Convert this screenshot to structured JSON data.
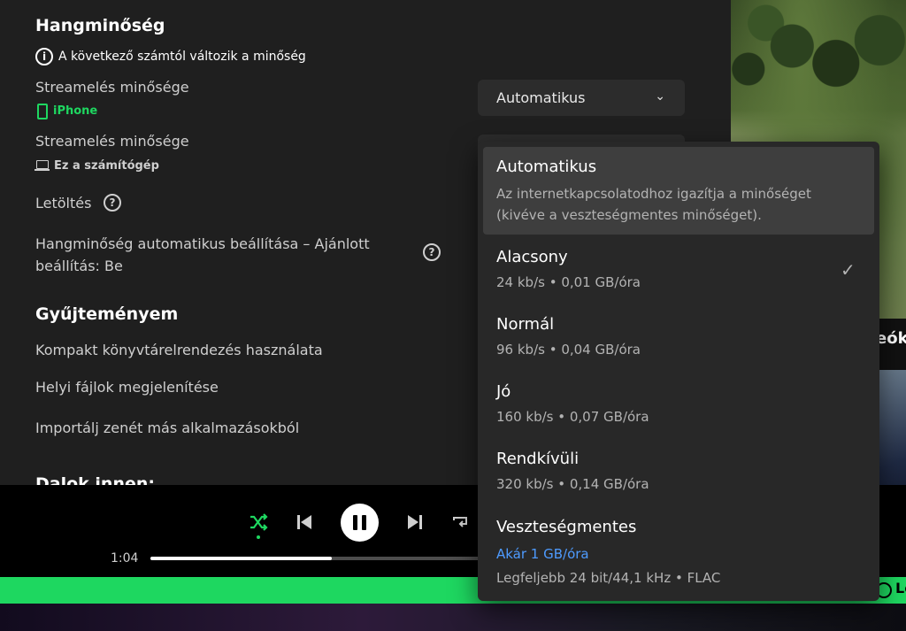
{
  "audio_quality": {
    "title": "Hangminőség",
    "notice": "A következő számtól változik a minőség",
    "streaming_label_1": "Streamelés minősége",
    "device_1": "iPhone",
    "streaming_label_2": "Streamelés minősége",
    "device_2": "Ez a számítógép",
    "download_label": "Letöltés",
    "auto_adjust_label": "Hangminőség automatikus beállítása – Ajánlott beállítás: Be",
    "select_value": "Automatikus"
  },
  "collection": {
    "title": "Gyűjteményem",
    "compact_label": "Kompakt könyvtárelrendezés használata",
    "local_files_label": "Helyi fájlok megjelenítése",
    "import_label": "Importálj zenét más alkalmazásokból",
    "songs_from_label": "Dalok innen:"
  },
  "dropdown": {
    "options": [
      {
        "label": "Automatikus",
        "desc": "Az internetkapcsolatodhoz igazítja a minőséget (kivéve a veszteségmentes minőséget)."
      },
      {
        "label": "Alacsony",
        "desc": "24 kb/s • 0,01 GB/óra",
        "checked": true
      },
      {
        "label": "Normál",
        "desc": "96 kb/s • 0,04 GB/óra"
      },
      {
        "label": "Jó",
        "desc": "160 kb/s • 0,07 GB/óra"
      },
      {
        "label": "Rendkívüli",
        "desc": "320 kb/s • 0,14 GB/óra"
      },
      {
        "label": "Veszteségmentes",
        "highlight": "Akár 1 GB/óra",
        "desc": "Legfeljebb 24 bit/44,1 kHz • FLAC"
      }
    ]
  },
  "player": {
    "elapsed": "1:04",
    "progress": 0.54
  },
  "side": {
    "partial_title": "eók",
    "green_bar_text": "Le"
  },
  "colors": {
    "accent_green": "#1ed760",
    "link_blue": "#4e9bff",
    "panel_bg": "#1f1f1f",
    "dropdown_bg": "#282828"
  }
}
